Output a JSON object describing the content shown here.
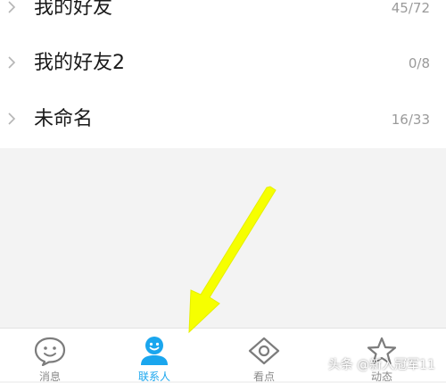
{
  "groups": [
    {
      "name": "我的好友",
      "count": "45/72"
    },
    {
      "name": "我的好友2",
      "count": "0/8"
    },
    {
      "name": "未命名",
      "count": "16/33"
    }
  ],
  "tabs": [
    {
      "label": "消息",
      "icon": "chat-bubble-smile-icon",
      "active": false
    },
    {
      "label": "联系人",
      "icon": "contact-person-icon",
      "active": true
    },
    {
      "label": "看点",
      "icon": "eye-diamond-icon",
      "active": false
    },
    {
      "label": "动态",
      "icon": "star-icon",
      "active": false
    }
  ],
  "colors": {
    "accent": "#1aa6ee",
    "annotation_arrow": "#f6ff00",
    "list_background": "#ffffff",
    "page_background": "#f3f3f3"
  },
  "watermark": "头条 @新入冠军11"
}
